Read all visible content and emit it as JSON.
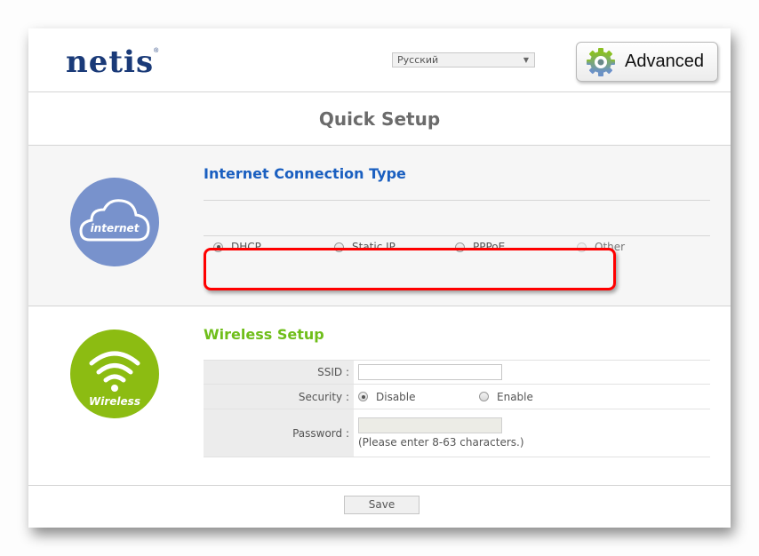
{
  "header": {
    "logo": "netis",
    "logo_mark": "®",
    "language": {
      "selected": "Русский"
    },
    "advanced_label": "Advanced"
  },
  "page_title": "Quick Setup",
  "internet": {
    "icon_label": "internet",
    "title": "Internet Connection Type",
    "options": [
      {
        "label": "DHCP",
        "checked": true,
        "disabled": false
      },
      {
        "label": "Static IP",
        "checked": false,
        "disabled": false
      },
      {
        "label": "PPPoE",
        "checked": false,
        "disabled": false
      },
      {
        "label": "Other",
        "checked": false,
        "disabled": true
      }
    ]
  },
  "wireless": {
    "icon_label": "Wireless",
    "title": "Wireless Setup",
    "ssid_label": "SSID :",
    "ssid_value": "",
    "security_label": "Security :",
    "security_options": [
      {
        "label": "Disable",
        "checked": true
      },
      {
        "label": "Enable",
        "checked": false
      }
    ],
    "password_label": "Password :",
    "password_value": "",
    "password_hint": "(Please enter 8-63 characters.)"
  },
  "footer": {
    "save_label": "Save"
  },
  "colors": {
    "brand": "#1a3a78",
    "internet_accent": "#1a5fc0",
    "wireless_accent": "#6fbe1a",
    "highlight": "#ff0000"
  }
}
